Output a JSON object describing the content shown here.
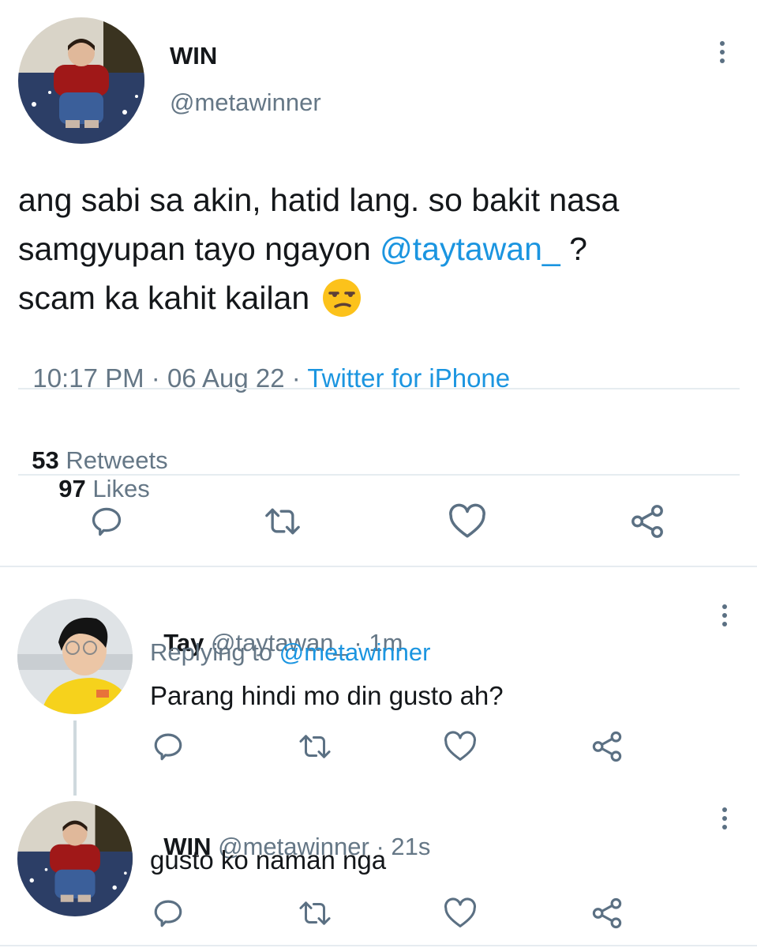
{
  "main_tweet": {
    "display_name": "WIN",
    "handle": "@metawinner",
    "text_line1": "ang sabi sa akin, hatid lang. so bakit nasa",
    "text_line2_a": "samgyupan tayo ngayon ",
    "mention": "@taytawan_",
    "text_line2_b": " ?",
    "text_line3": "scam ka kahit kailan",
    "emoji": "unamused-face-emoji",
    "time": "10:17 PM",
    "date": "06 Aug 22",
    "sep": "·",
    "source": "Twitter for iPhone",
    "retweets_count": "53",
    "retweets_label": "Retweets",
    "likes_count": "97",
    "likes_label": "Likes"
  },
  "reply1": {
    "display_name": "Tay",
    "handle": "@taytawan_",
    "time": "· 1m",
    "replying_to_label": "Replying to",
    "replying_to_handle": "@metawinner",
    "text": "Parang hindi mo din gusto ah?"
  },
  "reply2": {
    "display_name": "WIN",
    "handle": "@metawinner",
    "time": "· 21s",
    "text": "gusto ko naman nga"
  },
  "icons": {
    "reply": "reply-icon",
    "retweet": "retweet-icon",
    "like": "heart-icon",
    "share": "share-icon",
    "more": "more-icon"
  },
  "colors": {
    "accent": "#1b95e0",
    "text": "#14171a",
    "muted": "#657786",
    "divider": "#e6ecf0"
  }
}
